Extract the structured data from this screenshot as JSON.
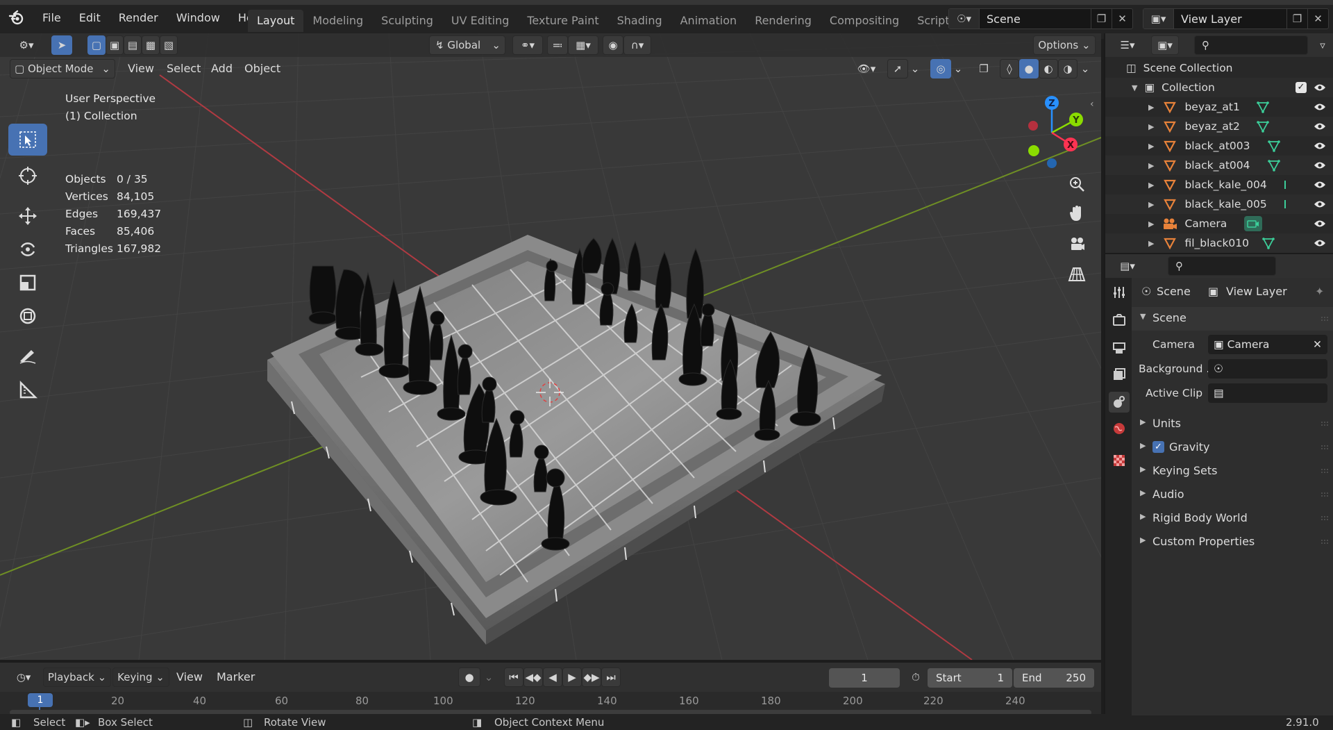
{
  "app": {
    "menu": [
      "File",
      "Edit",
      "Render",
      "Window",
      "Help"
    ],
    "workspaces": [
      "Layout",
      "Modeling",
      "Sculpting",
      "UV Editing",
      "Texture Paint",
      "Shading",
      "Animation",
      "Rendering",
      "Compositing",
      "Scripting"
    ],
    "active_workspace": "Layout",
    "add_workspace": "+",
    "scene_name": "Scene",
    "view_layer_name": "View Layer"
  },
  "viewport": {
    "mode": "Object Mode",
    "menus": [
      "View",
      "Select",
      "Add",
      "Object"
    ],
    "orientation": "Global",
    "options": "Options",
    "perspective": "User Perspective",
    "collection": "(1) Collection",
    "stats": [
      {
        "label": "Objects",
        "value": "0 / 35"
      },
      {
        "label": "Vertices",
        "value": "84,105"
      },
      {
        "label": "Edges",
        "value": "169,437"
      },
      {
        "label": "Faces",
        "value": "85,406"
      },
      {
        "label": "Triangles",
        "value": "167,982"
      }
    ],
    "gizmo": {
      "z": "Z",
      "y": "Y",
      "x": "X"
    }
  },
  "timeline": {
    "menus": [
      "Playback",
      "Keying",
      "View",
      "Marker"
    ],
    "current_frame": "1",
    "start_label": "Start",
    "start_value": "1",
    "end_label": "End",
    "end_value": "250",
    "ruler": [
      "1",
      "20",
      "40",
      "60",
      "80",
      "100",
      "120",
      "140",
      "160",
      "180",
      "200",
      "220",
      "240"
    ]
  },
  "statusbar": {
    "select": "Select",
    "box_select": "Box Select",
    "rotate_view": "Rotate View",
    "context_menu": "Object Context Menu",
    "version": "2.91.0"
  },
  "outliner": {
    "root": "Scene Collection",
    "collection": "Collection",
    "items": [
      {
        "name": "beyaz_at1",
        "type": "mesh"
      },
      {
        "name": "beyaz_at2",
        "type": "mesh"
      },
      {
        "name": "black_at003",
        "type": "mesh"
      },
      {
        "name": "black_at004",
        "type": "mesh"
      },
      {
        "name": "black_kale_004",
        "type": "mesh"
      },
      {
        "name": "black_kale_005",
        "type": "mesh"
      },
      {
        "name": "Camera",
        "type": "camera"
      },
      {
        "name": "fil_black010",
        "type": "mesh"
      }
    ]
  },
  "properties": {
    "breadcrumb_scene": "Scene",
    "breadcrumb_view_layer": "View Layer",
    "panel_title": "Scene",
    "camera_label": "Camera",
    "camera_value": "Camera",
    "background_label": "Background ...",
    "active_clip_label": "Active Clip",
    "subpanels": [
      "Units",
      "Gravity",
      "Keying Sets",
      "Audio",
      "Rigid Body World",
      "Custom Properties"
    ],
    "gravity_checked": true
  },
  "colors": {
    "accent": "#4772b3",
    "x_axis": "#ff3352",
    "y_axis": "#8bdc00",
    "z_axis": "#2890ff",
    "mesh_icon": "#e8823a",
    "mesh_data": "#3ccf9a"
  }
}
